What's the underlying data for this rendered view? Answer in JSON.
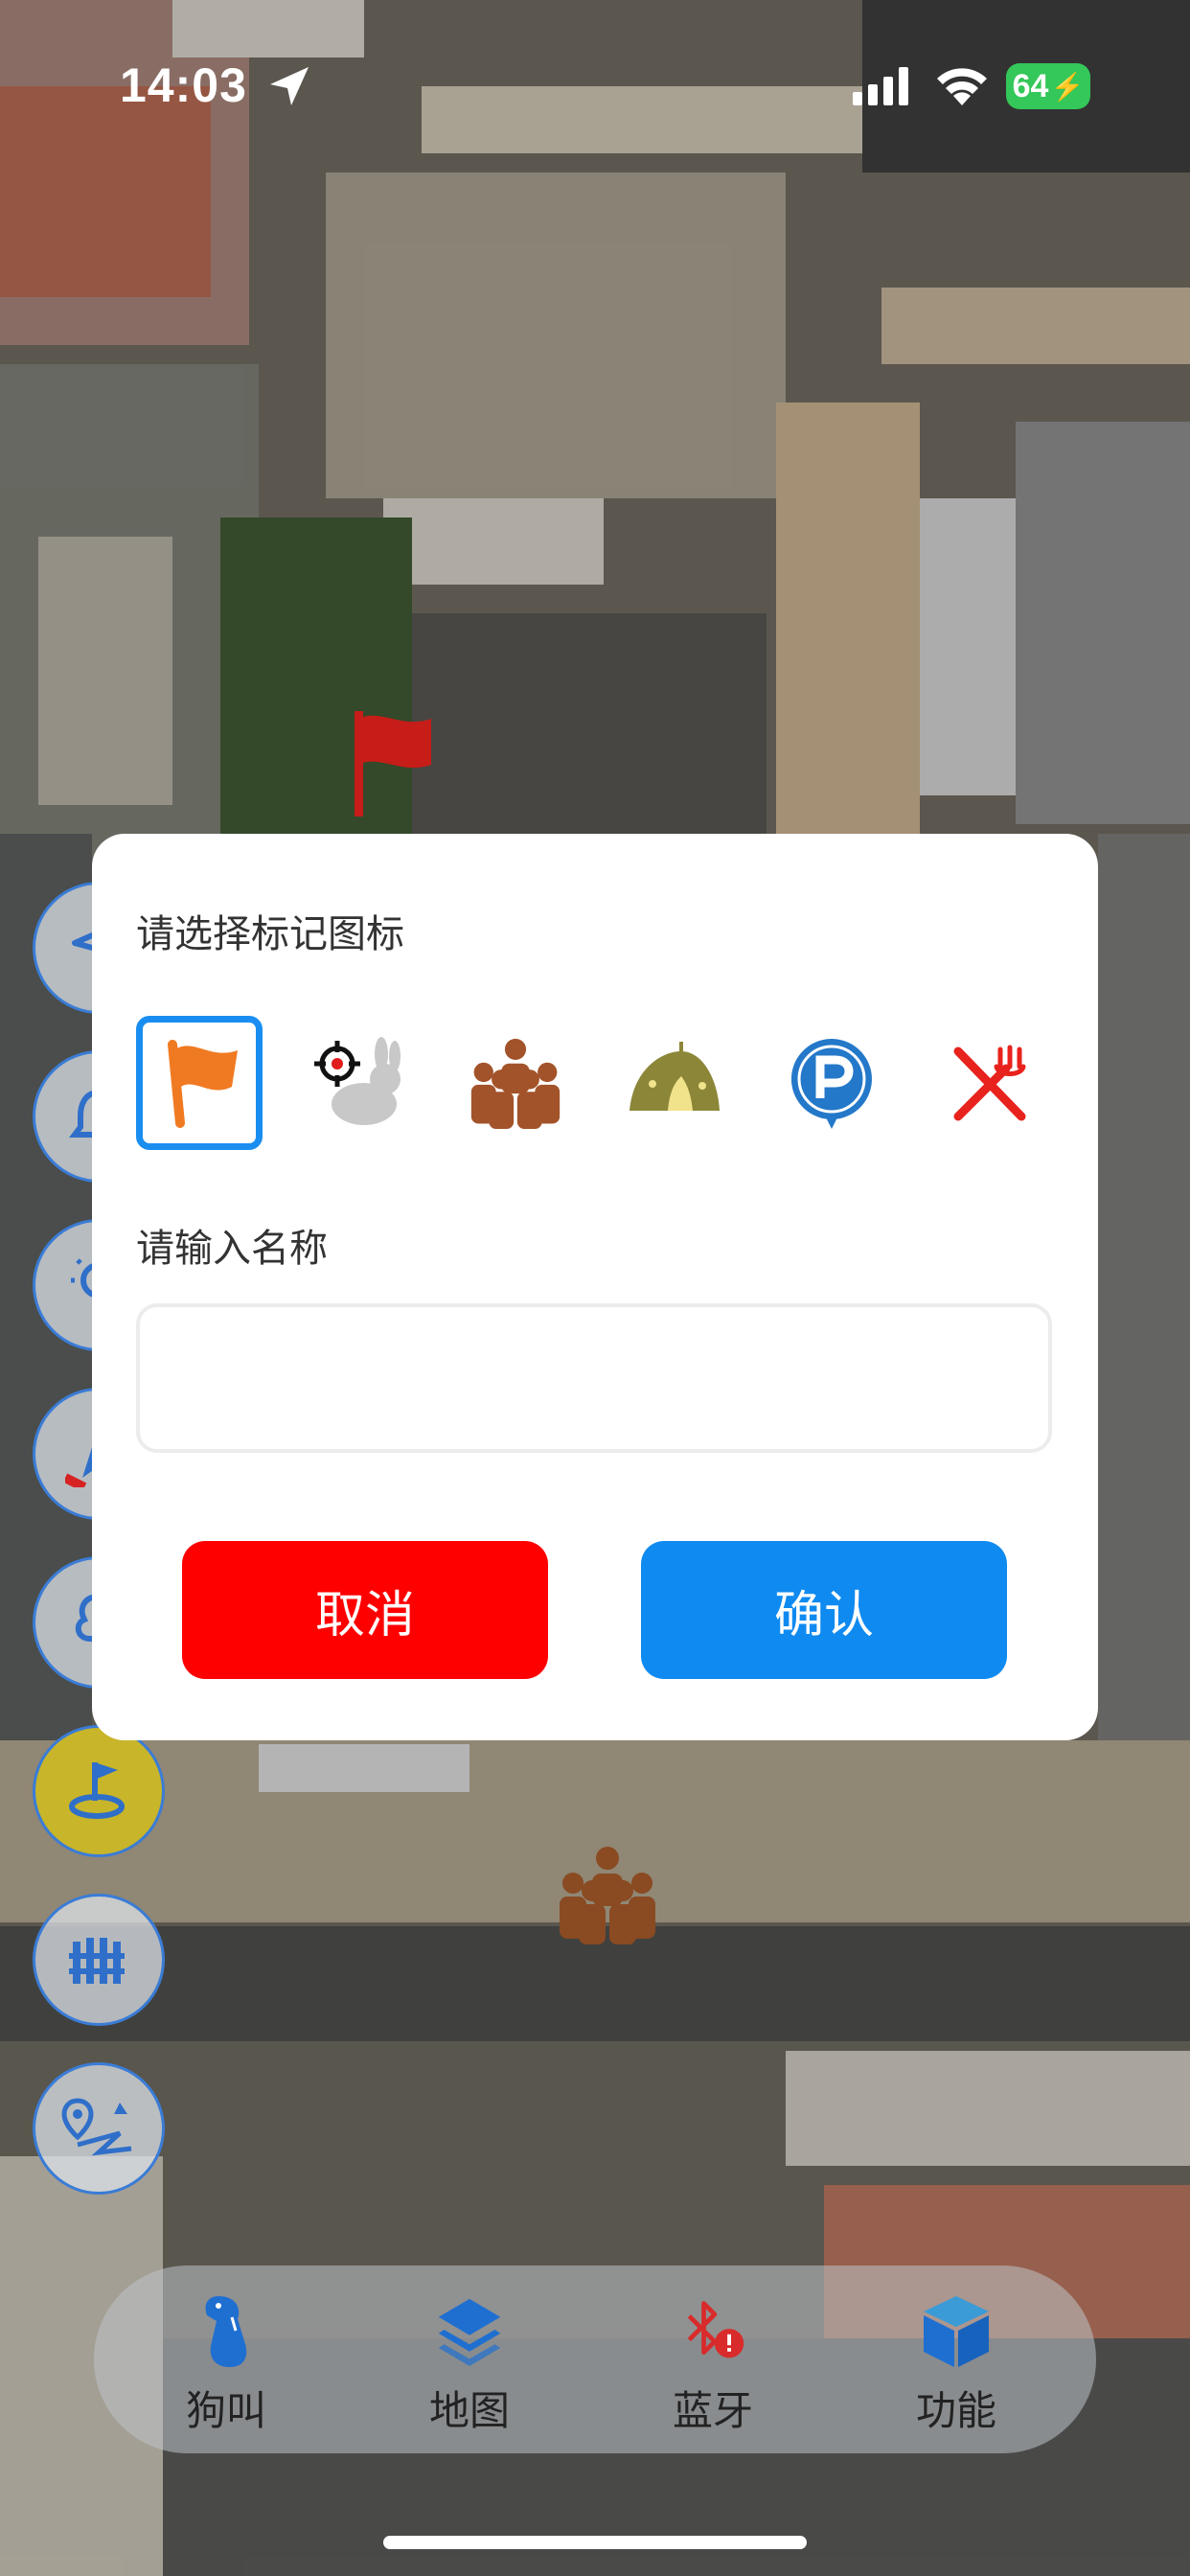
{
  "status_bar": {
    "time": "14:03",
    "battery": "64",
    "icons": [
      "location-arrow-icon",
      "cellular-signal-icon",
      "wifi-icon",
      "battery-charging-icon"
    ]
  },
  "map_tools": [
    "location-pointer-icon",
    "bell-icon",
    "bulb-icon",
    "compass-icon",
    "fence-icon",
    "flag-marker-icon",
    "grid-fence-icon",
    "route-icon"
  ],
  "dialog": {
    "title": "请选择标记图标",
    "icon_options": [
      "orange-flag-icon",
      "rabbit-target-icon",
      "people-group-icon",
      "tent-icon",
      "parking-icon",
      "restaurant-icon"
    ],
    "selected_icon": "orange-flag-icon",
    "name_label": "请输入名称",
    "name_value": "",
    "name_placeholder": "",
    "cancel_label": "取消",
    "confirm_label": "确认",
    "colors": {
      "cancel": "#ff0000",
      "confirm": "#0f8af0",
      "selected_border": "#1a8ef0"
    }
  },
  "bottom_nav": {
    "items": [
      {
        "label": "狗叫",
        "icon": "dog-icon"
      },
      {
        "label": "地图",
        "icon": "map-layers-icon"
      },
      {
        "label": "蓝牙",
        "icon": "bluetooth-error-icon"
      },
      {
        "label": "功能",
        "icon": "cube-icon"
      }
    ]
  }
}
